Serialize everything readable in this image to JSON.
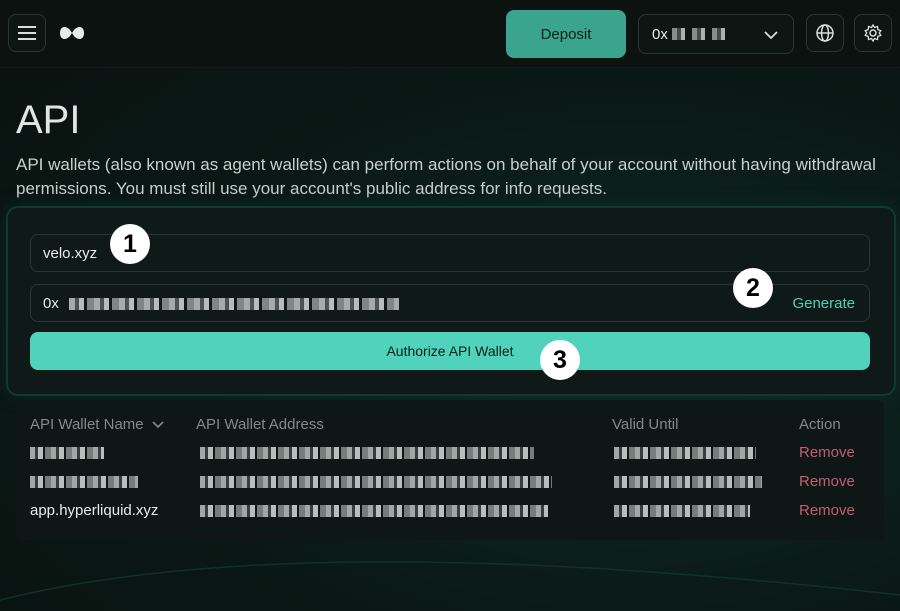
{
  "topbar": {
    "deposit_label": "Deposit",
    "address_prefix": "0x"
  },
  "page": {
    "title": "API",
    "description": "API wallets (also known as agent wallets) can perform actions on behalf of your account without having withdrawal permissions. You must still use your account's public address for info requests."
  },
  "form": {
    "name_value": "velo.xyz",
    "address_prefix": "0x",
    "generate_label": "Generate",
    "authorize_label": "Authorize API Wallet"
  },
  "badges": [
    "1",
    "2",
    "3"
  ],
  "table": {
    "headers": {
      "name": "API Wallet Name",
      "address": "API Wallet Address",
      "valid_until": "Valid Until",
      "action": "Action"
    },
    "rows": [
      {
        "name": "",
        "remove": "Remove"
      },
      {
        "name": "",
        "remove": "Remove"
      },
      {
        "name": "app.hyperliquid.xyz",
        "remove": "Remove"
      }
    ]
  },
  "colors": {
    "accent": "#50d2bc",
    "deposit": "#3aa58c",
    "remove": "#c25e6e",
    "background": "#0a1815"
  }
}
